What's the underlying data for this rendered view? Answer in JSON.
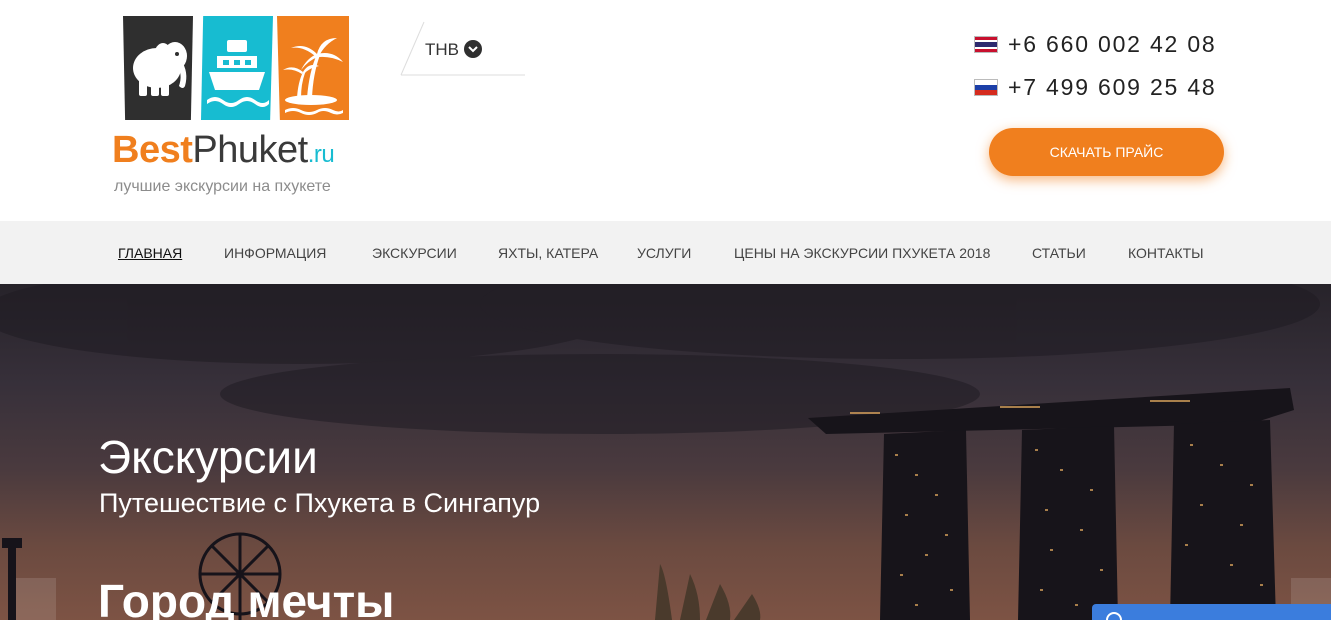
{
  "logo": {
    "brand_best": "Best",
    "brand_phuket": "Phuket",
    "brand_tld": ".ru",
    "tagline": "лучшие экскурсии на пхукете",
    "tile_icons": [
      "elephant-icon",
      "boat-icon",
      "palm-island-icon"
    ],
    "colors": {
      "dark": "#2f2f2f",
      "cyan": "#17bcd1",
      "orange": "#f07f1e"
    }
  },
  "currency": {
    "selected": "THB",
    "icon": "chevron-down-icon"
  },
  "contacts": {
    "phone_thailand": "+6 660 002 42 08",
    "phone_russia": "+7 499 609 25 48",
    "flags": [
      "thailand-flag-icon",
      "russia-flag-icon"
    ]
  },
  "cta": {
    "download_price": "СКАЧАТЬ ПРАЙС",
    "color": "#f07f1e"
  },
  "nav": {
    "items": [
      {
        "label": "ГЛАВНАЯ",
        "active": true
      },
      {
        "label": "ИНФОРМАЦИЯ"
      },
      {
        "label": "ЭКСКУРСИИ"
      },
      {
        "label": "ЯХТЫ, КАТЕРА"
      },
      {
        "label": "УСЛУГИ"
      },
      {
        "label": "ЦЕНЫ НА ЭКСКУРСИИ ПХУКЕТА 2018"
      },
      {
        "label": "СТАТЬИ"
      },
      {
        "label": "КОНТАКТЫ"
      }
    ]
  },
  "hero": {
    "title": "Экскурсии",
    "subtitle": "Путешествие с Пхукета в Сингапур",
    "heading": "Город мечты"
  }
}
